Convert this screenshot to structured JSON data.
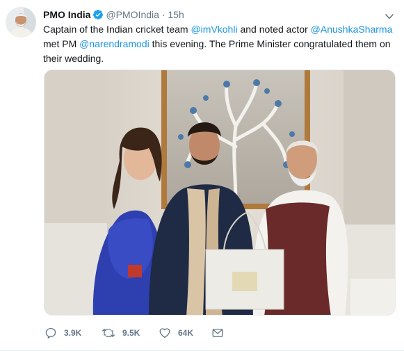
{
  "tweet": {
    "author_name": "PMO India",
    "author_handle": "@PMOIndia",
    "separator": "·",
    "time": "15h",
    "text_segments": [
      {
        "text": "Captain of the Indian cricket team ",
        "mention": false
      },
      {
        "text": "@imVkohli",
        "mention": true
      },
      {
        "text": " and noted actor ",
        "mention": false
      },
      {
        "text": "@AnushkaSharma",
        "mention": true
      },
      {
        "text": " met PM ",
        "mention": false
      },
      {
        "text": "@narendramodi",
        "mention": true
      },
      {
        "text": " this evening. The Prime Minister congratulated them on their wedding.",
        "mention": false
      }
    ],
    "actions": {
      "replies": "3.9K",
      "retweets": "9.5K",
      "likes": "64K"
    }
  },
  "icons": {
    "verified": "verified-badge-icon",
    "caret": "chevron-down-icon",
    "reply": "reply-icon",
    "retweet": "retweet-icon",
    "like": "heart-icon",
    "dm": "envelope-icon"
  },
  "colors": {
    "accent": "#1da1f2",
    "mention": "#1b95e0",
    "muted": "#657786",
    "text": "#14171a"
  }
}
